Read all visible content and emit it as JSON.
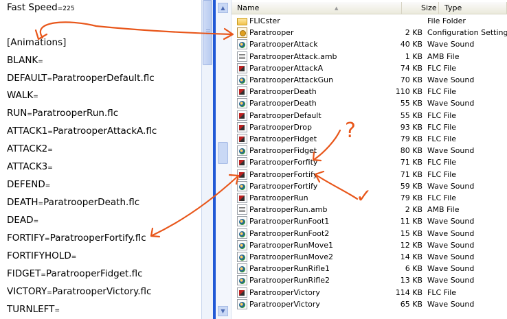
{
  "editor": {
    "lines": [
      {
        "key": "Fast Speed",
        "sep": "=",
        "val": "225"
      },
      {
        "key": "",
        "sep": "",
        "val": ""
      },
      {
        "key": "[Animations]",
        "sep": "",
        "val": ""
      },
      {
        "key": "BLANK",
        "sep": "=",
        "val": ""
      },
      {
        "key": "DEFAULT",
        "sep": "=",
        "val": "ParatrooperDefault.flc"
      },
      {
        "key": "WALK",
        "sep": "=",
        "val": ""
      },
      {
        "key": "RUN",
        "sep": "=",
        "val": "ParatrooperRun.flc"
      },
      {
        "key": "ATTACK1",
        "sep": "=",
        "val": "ParatrooperAttackA.flc"
      },
      {
        "key": "ATTACK2",
        "sep": "=",
        "val": ""
      },
      {
        "key": "ATTACK3",
        "sep": "=",
        "val": ""
      },
      {
        "key": "DEFEND",
        "sep": "=",
        "val": ""
      },
      {
        "key": "DEATH",
        "sep": "=",
        "val": "ParatrooperDeath.flc"
      },
      {
        "key": "DEAD",
        "sep": "=",
        "val": ""
      },
      {
        "key": "FORTIFY",
        "sep": "=",
        "val": "ParatrooperFortify.flc"
      },
      {
        "key": "FORTIFYHOLD",
        "sep": "=",
        "val": ""
      },
      {
        "key": "FIDGET",
        "sep": "=",
        "val": "ParatrooperFidget.flc"
      },
      {
        "key": "VICTORY",
        "sep": "=",
        "val": "ParatrooperVictory.flc"
      },
      {
        "key": "TURNLEFT",
        "sep": "=",
        "val": ""
      }
    ]
  },
  "explorer": {
    "columns": {
      "name": "Name",
      "size": "Size",
      "type": "Type"
    },
    "files": [
      {
        "name": "FLICster",
        "size": "",
        "type": "File Folder",
        "icon": "folder-icon"
      },
      {
        "name": "Paratrooper",
        "size": "2 KB",
        "type": "Configuration Settings",
        "icon": "config-settings-icon"
      },
      {
        "name": "ParatrooperAttack",
        "size": "40 KB",
        "type": "Wave Sound",
        "icon": "wave-sound-icon"
      },
      {
        "name": "ParatrooperAttack.amb",
        "size": "1 KB",
        "type": "AMB File",
        "icon": "document-icon"
      },
      {
        "name": "ParatrooperAttackA",
        "size": "74 KB",
        "type": "FLC File",
        "icon": "flc-file-icon"
      },
      {
        "name": "ParatrooperAttackGun",
        "size": "70 KB",
        "type": "Wave Sound",
        "icon": "wave-sound-icon"
      },
      {
        "name": "ParatrooperDeath",
        "size": "110 KB",
        "type": "FLC File",
        "icon": "flc-file-icon"
      },
      {
        "name": "ParatrooperDeath",
        "size": "55 KB",
        "type": "Wave Sound",
        "icon": "wave-sound-icon"
      },
      {
        "name": "ParatrooperDefault",
        "size": "55 KB",
        "type": "FLC File",
        "icon": "flc-file-icon"
      },
      {
        "name": "ParatrooperDrop",
        "size": "93 KB",
        "type": "FLC File",
        "icon": "flc-file-icon"
      },
      {
        "name": "ParatrooperFidget",
        "size": "79 KB",
        "type": "FLC File",
        "icon": "flc-file-icon"
      },
      {
        "name": "ParatrooperFidget",
        "size": "80 KB",
        "type": "Wave Sound",
        "icon": "wave-sound-icon"
      },
      {
        "name": "ParatrooperForfity",
        "size": "71 KB",
        "type": "FLC File",
        "icon": "flc-file-icon"
      },
      {
        "name": "ParatrooperFortify",
        "size": "71 KB",
        "type": "FLC File",
        "icon": "flc-file-icon"
      },
      {
        "name": "ParatrooperFortify",
        "size": "59 KB",
        "type": "Wave Sound",
        "icon": "wave-sound-icon"
      },
      {
        "name": "ParatrooperRun",
        "size": "79 KB",
        "type": "FLC File",
        "icon": "flc-file-icon"
      },
      {
        "name": "ParatrooperRun.amb",
        "size": "2 KB",
        "type": "AMB File",
        "icon": "document-icon"
      },
      {
        "name": "ParatrooperRunFoot1",
        "size": "11 KB",
        "type": "Wave Sound",
        "icon": "wave-sound-icon"
      },
      {
        "name": "ParatrooperRunFoot2",
        "size": "15 KB",
        "type": "Wave Sound",
        "icon": "wave-sound-icon"
      },
      {
        "name": "ParatrooperRunMove1",
        "size": "12 KB",
        "type": "Wave Sound",
        "icon": "wave-sound-icon"
      },
      {
        "name": "ParatrooperRunMove2",
        "size": "14 KB",
        "type": "Wave Sound",
        "icon": "wave-sound-icon"
      },
      {
        "name": "ParatrooperRunRifle1",
        "size": "6 KB",
        "type": "Wave Sound",
        "icon": "wave-sound-icon"
      },
      {
        "name": "ParatrooperRunRifle2",
        "size": "13 KB",
        "type": "Wave Sound",
        "icon": "wave-sound-icon"
      },
      {
        "name": "ParatrooperVictory",
        "size": "114 KB",
        "type": "FLC File",
        "icon": "flc-file-icon"
      },
      {
        "name": "ParatrooperVictory",
        "size": "65 KB",
        "type": "Wave Sound",
        "icon": "wave-sound-icon"
      }
    ]
  },
  "annotations": {
    "question_mark": "?",
    "check_mark": "✓",
    "color": "#e8561a"
  },
  "colors": {
    "divider": "#2159d6",
    "header_bg": "#ebeadb"
  }
}
